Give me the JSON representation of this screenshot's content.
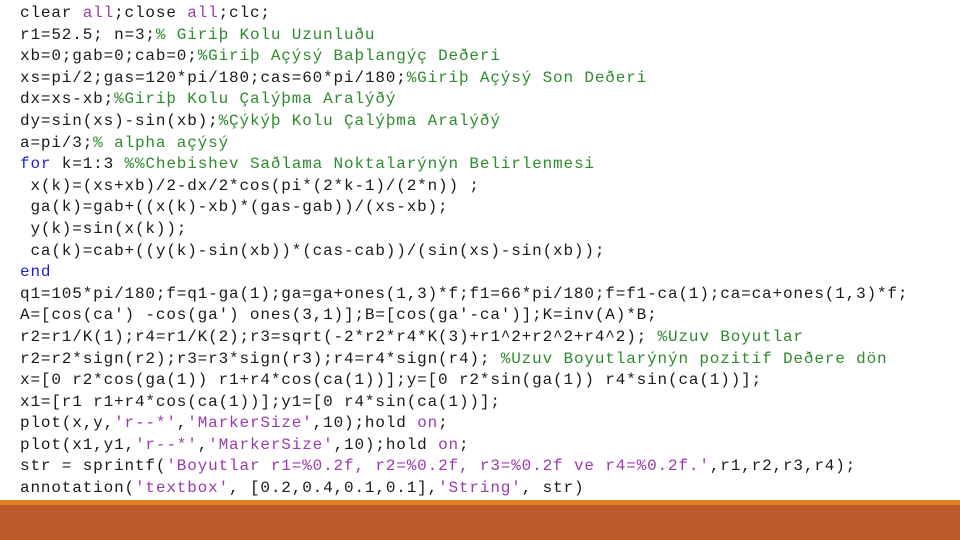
{
  "colors": {
    "code": "#1a1a1a",
    "keyword": "#1f1fd0",
    "string": "#9a3ab0",
    "comment": "#2f8a2f",
    "footer": "#bd5a2c",
    "stripe": "#e2801f"
  },
  "code_lines": [
    [
      [
        "code",
        "clear "
      ],
      [
        "string",
        "all"
      ],
      [
        "code",
        ";close "
      ],
      [
        "string",
        "all"
      ],
      [
        "code",
        ";clc;"
      ]
    ],
    [
      [
        "code",
        "r1=52.5; n=3;"
      ],
      [
        "comment",
        "% Giriþ Kolu Uzunluðu"
      ]
    ],
    [
      [
        "code",
        "xb=0;gab=0;cab=0;"
      ],
      [
        "comment",
        "%Giriþ Açýsý Baþlangýç Deðeri"
      ]
    ],
    [
      [
        "code",
        "xs=pi/2;gas=120*pi/180;cas=60*pi/180;"
      ],
      [
        "comment",
        "%Giriþ Açýsý Son Deðeri"
      ]
    ],
    [
      [
        "code",
        "dx=xs-xb;"
      ],
      [
        "comment",
        "%Giriþ Kolu Çalýþma Aralýðý"
      ]
    ],
    [
      [
        "code",
        "dy=sin(xs)-sin(xb);"
      ],
      [
        "comment",
        "%Çýkýþ Kolu Çalýþma Aralýðý"
      ]
    ],
    [
      [
        "code",
        "a=pi/3;"
      ],
      [
        "comment",
        "% alpha açýsý"
      ]
    ],
    [
      [
        "keyword",
        "for"
      ],
      [
        "code",
        " k=1:3 "
      ],
      [
        "comment",
        "%%Chebishev Saðlama Noktalarýnýn Belirlenmesi"
      ]
    ],
    [
      [
        "code",
        " x(k)=(xs+xb)/2-dx/2*cos(pi*(2*k-1)/(2*n)) ;"
      ]
    ],
    [
      [
        "code",
        " ga(k)=gab+((x(k)-xb)*(gas-gab))/(xs-xb);"
      ]
    ],
    [
      [
        "code",
        " y(k)=sin(x(k));"
      ]
    ],
    [
      [
        "code",
        " ca(k)=cab+((y(k)-sin(xb))*(cas-cab))/(sin(xs)-sin(xb));"
      ]
    ],
    [
      [
        "keyword",
        "end"
      ]
    ],
    [
      [
        "code",
        "q1=105*pi/180;f=q1-ga(1);ga=ga+ones(1,3)*f;f1=66*pi/180;f=f1-ca(1);ca=ca+ones(1,3)*f;"
      ]
    ],
    [
      [
        "code",
        "A=[cos(ca') -cos(ga') ones(3,1)];B=[cos(ga'-ca')];K=inv(A)*B;"
      ]
    ],
    [
      [
        "code",
        "r2=r1/K(1);r4=r1/K(2);r3=sqrt(-2*r2*r4*K(3)+r1^2+r2^2+r4^2); "
      ],
      [
        "comment",
        "%Uzuv Boyutlar"
      ]
    ],
    [
      [
        "code",
        "r2=r2*sign(r2);r3=r3*sign(r3);r4=r4*sign(r4); "
      ],
      [
        "comment",
        "%Uzuv Boyutlarýnýn pozitif Deðere dön"
      ]
    ],
    [
      [
        "code",
        "x=[0 r2*cos(ga(1)) r1+r4*cos(ca(1))];y=[0 r2*sin(ga(1)) r4*sin(ca(1))];"
      ]
    ],
    [
      [
        "code",
        "x1=[r1 r1+r4*cos(ca(1))];y1=[0 r4*sin(ca(1))];"
      ]
    ],
    [
      [
        "code",
        "plot(x,y,"
      ],
      [
        "string",
        "'r--*'"
      ],
      [
        "code",
        ","
      ],
      [
        "string",
        "'MarkerSize'"
      ],
      [
        "code",
        ",10);hold "
      ],
      [
        "string",
        "on"
      ],
      [
        "code",
        ";"
      ]
    ],
    [
      [
        "code",
        "plot(x1,y1,"
      ],
      [
        "string",
        "'r--*'"
      ],
      [
        "code",
        ","
      ],
      [
        "string",
        "'MarkerSize'"
      ],
      [
        "code",
        ",10);hold "
      ],
      [
        "string",
        "on"
      ],
      [
        "code",
        ";"
      ]
    ],
    [
      [
        "code",
        "str = sprintf("
      ],
      [
        "string",
        "'Boyutlar r1=%0.2f, r2=%0.2f, r3=%0.2f ve r4=%0.2f.'"
      ],
      [
        "code",
        ",r1,r2,r3,r4);"
      ]
    ],
    [
      [
        "code",
        "annotation("
      ],
      [
        "string",
        "'textbox'"
      ],
      [
        "code",
        ", [0.2,0.4,0.1,0.1],"
      ],
      [
        "string",
        "'String'"
      ],
      [
        "code",
        ", str)"
      ]
    ]
  ]
}
